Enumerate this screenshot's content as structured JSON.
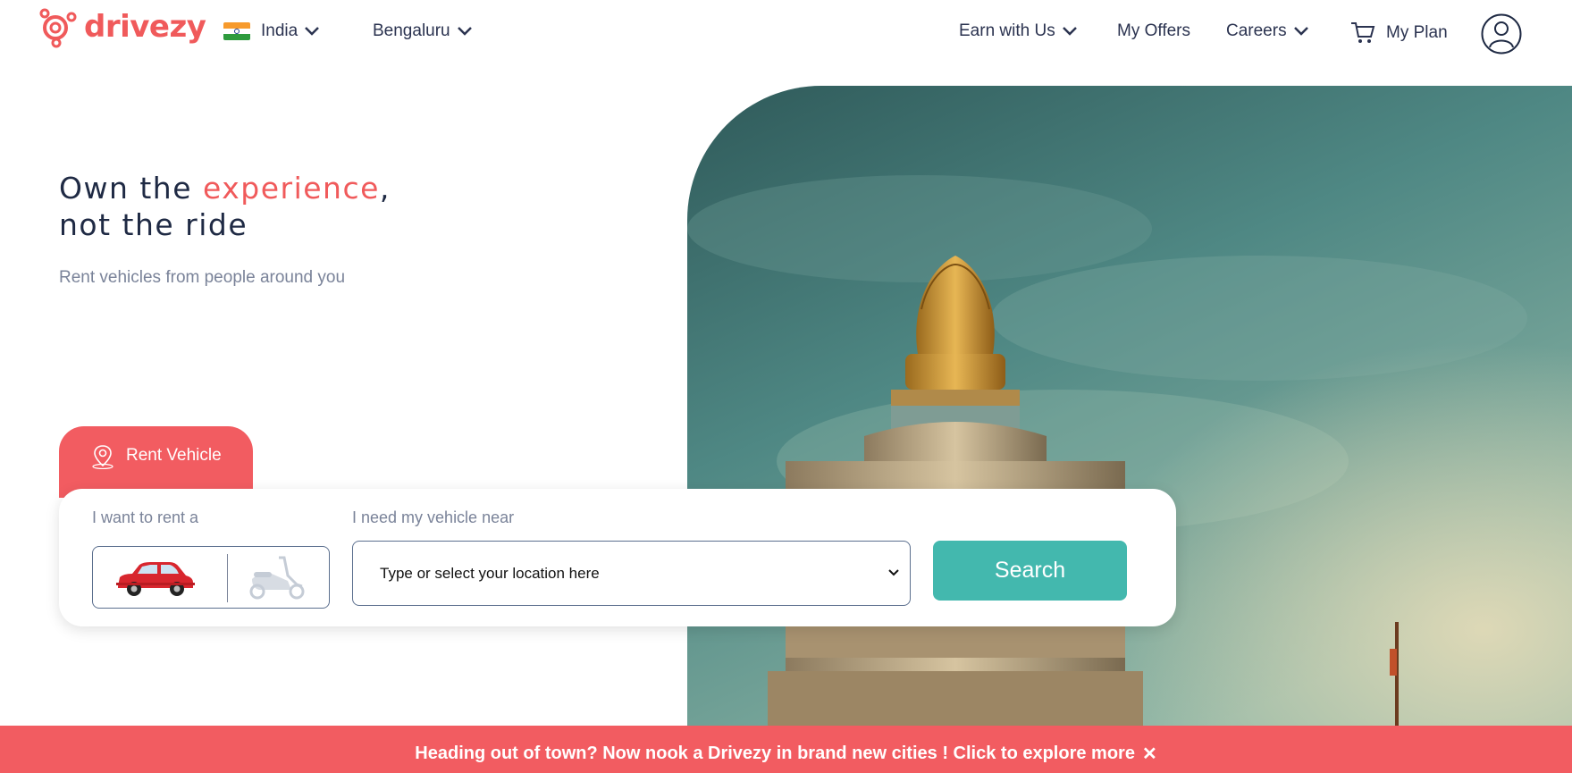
{
  "brand": {
    "name": "drivezy",
    "color": "#f05a5b"
  },
  "nav": {
    "country": "India",
    "city": "Bengaluru",
    "earn": "Earn with Us",
    "offers": "My Offers",
    "careers": "Careers",
    "plan": "My Plan"
  },
  "hero": {
    "headline_pre": "Own the ",
    "headline_accent": "experience",
    "headline_comma": ",",
    "headline_line2": "not the ride",
    "subtitle": "Rent vehicles from people around you"
  },
  "search": {
    "tab_label": "Rent Vehicle",
    "rent_label": "I want to rent a",
    "location_label": "I need my vehicle near",
    "location_placeholder": "Type or select your location here",
    "button_label": "Search",
    "vehicle_options": [
      "car-icon",
      "scooter-icon"
    ]
  },
  "banner": {
    "text": "Heading out of town? Now nook a Drivezy in brand new cities ! Click to explore more",
    "close": "✕"
  },
  "colors": {
    "accent": "#f05a5b",
    "search_button": "#43b8ae",
    "text_dark": "#1f2a44",
    "text_muted": "#7a8399"
  }
}
